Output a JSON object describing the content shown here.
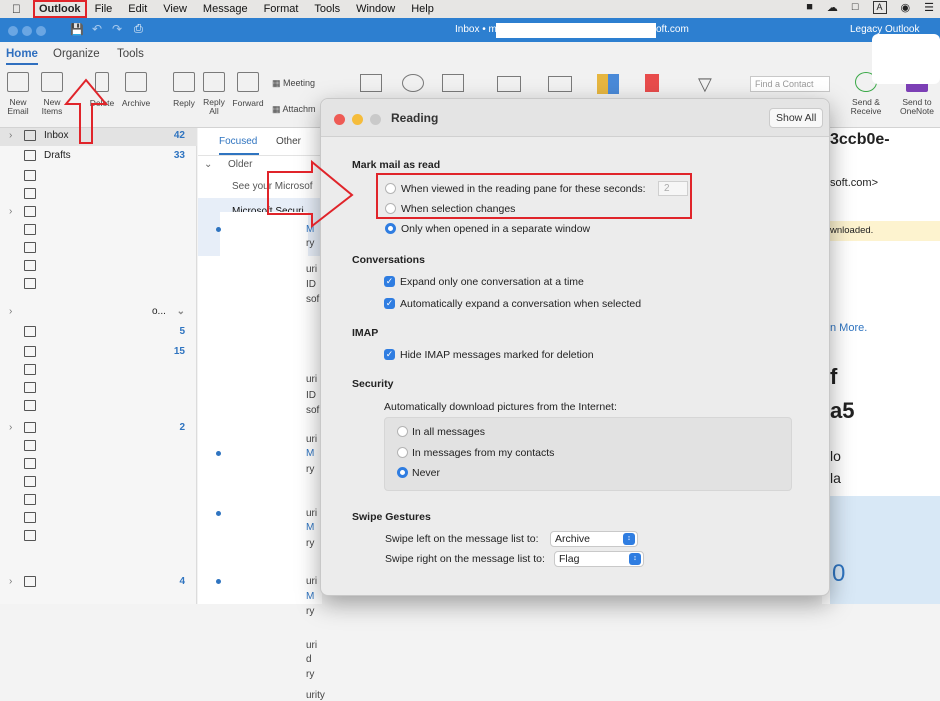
{
  "menubar": {
    "apple": "",
    "app": "Outlook",
    "items": [
      "File",
      "Edit",
      "View",
      "Message",
      "Format",
      "Tools",
      "Window",
      "Help"
    ],
    "right": [
      "A"
    ]
  },
  "titlebar": {
    "title": "Inbox • m",
    "title_suffix": "oft.com",
    "right": "Legacy Outlook"
  },
  "ribbon_tabs": [
    "Home",
    "Organize",
    "Tools"
  ],
  "ribbon": {
    "new_email": "New\nEmail",
    "new_items": "New\nItems",
    "delete": "Delete",
    "archive": "Archive",
    "reply": "Reply",
    "reply_all": "Reply\nAll",
    "forward": "Forward",
    "meeting": "Meeting",
    "attachment": "Attachm",
    "find_contact": "Find a Contact",
    "send_receive": "Send &\nReceive",
    "send_onenote": "Send to\nOneNote"
  },
  "folders": [
    {
      "label": "Inbox",
      "count": "42"
    },
    {
      "label": "Drafts",
      "count": "33"
    },
    {
      "label": "",
      "count": ""
    },
    {
      "label": "",
      "count": ""
    },
    {
      "label": "",
      "count": ""
    },
    {
      "label": "",
      "count": ""
    },
    {
      "label": "",
      "count": ""
    },
    {
      "label": "",
      "count": ""
    },
    {
      "label": "",
      "count": ""
    },
    {
      "label": "o...",
      "count": ""
    },
    {
      "label": "",
      "count": "5"
    },
    {
      "label": "",
      "count": "15"
    },
    {
      "label": "",
      "count": ""
    },
    {
      "label": "",
      "count": ""
    },
    {
      "label": "",
      "count": ""
    },
    {
      "label": "",
      "count": "2"
    },
    {
      "label": "",
      "count": ""
    },
    {
      "label": "",
      "count": ""
    },
    {
      "label": "",
      "count": ""
    },
    {
      "label": "",
      "count": ""
    },
    {
      "label": "",
      "count": ""
    },
    {
      "label": "",
      "count": ""
    },
    {
      "label": "",
      "count": "4"
    }
  ],
  "message_list": {
    "tab_focused": "Focused",
    "tab_other": "Other",
    "group": "Older",
    "preview1": "See your Microsof",
    "sender1": "Microsoft Securi",
    "fragments": [
      "M",
      "ry",
      "uri",
      "ID",
      "sof",
      "uri",
      "ID",
      "sof",
      "uri",
      "M",
      "ry",
      "uri",
      "M",
      "ry",
      "uri",
      "M",
      "ry",
      "uri",
      "d",
      "ry",
      "urity"
    ]
  },
  "reading_pane": {
    "subject_fragment": "3ccb0e-",
    "from_fragment": "soft.com>",
    "banner_fragment": "wnloaded.",
    "link_fragment": "n More.",
    "big1": "f",
    "big2": "a5",
    "t1": "lo",
    "t2": "la",
    "t3": "0"
  },
  "dialog": {
    "title": "Reading",
    "show_all": "Show All",
    "mark_read": {
      "heading": "Mark mail as read",
      "opt1": "When viewed in the reading pane for these seconds:",
      "opt1_value": "2",
      "opt2": "When selection changes",
      "opt3": "Only when opened in a separate window"
    },
    "conversations": {
      "heading": "Conversations",
      "opt1": "Expand only one conversation at a time",
      "opt2": "Automatically expand a conversation when selected"
    },
    "imap": {
      "heading": "IMAP",
      "opt1": "Hide IMAP messages marked for deletion"
    },
    "security": {
      "heading": "Security",
      "desc": "Automatically download pictures from the Internet:",
      "opt1": "In all messages",
      "opt2": "In messages from my contacts",
      "opt3": "Never"
    },
    "swipe": {
      "heading": "Swipe Gestures",
      "left_label": "Swipe left on the message list to:",
      "left_value": "Archive",
      "right_label": "Swipe right on the message list to:",
      "right_value": "Flag"
    }
  },
  "colors": {
    "accent": "#2f7de1",
    "titlebar": "#2d7fd0",
    "annotation": "#e0242a",
    "count": "#2f74c0"
  }
}
